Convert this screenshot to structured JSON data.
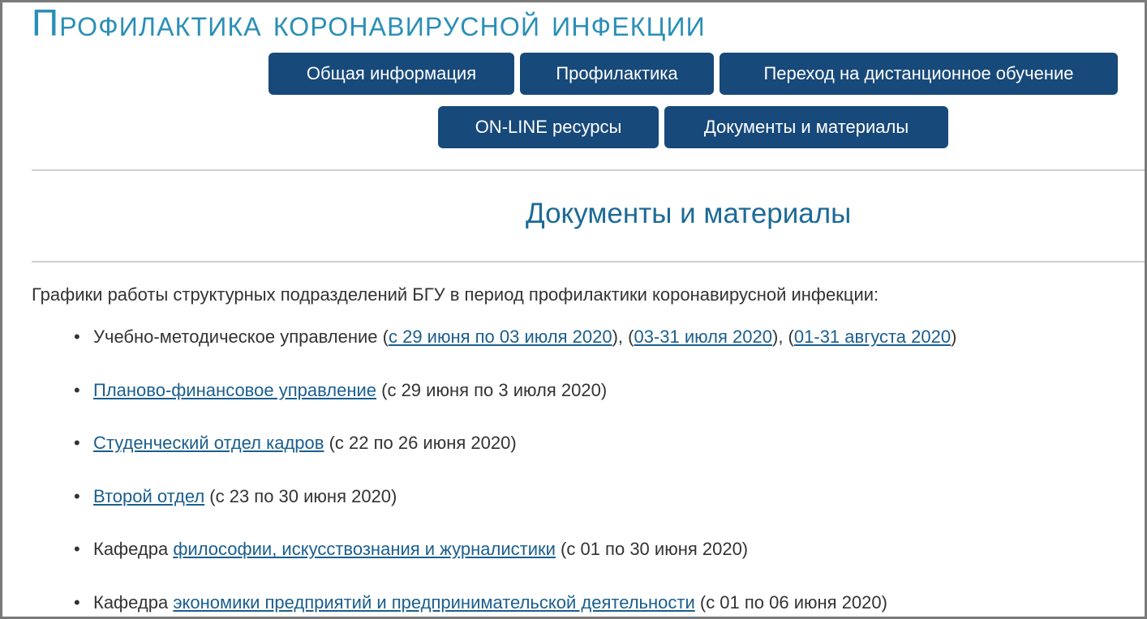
{
  "header": {
    "title": "Профилактика коронавирусной инфекции"
  },
  "nav": {
    "general": "Общая информация",
    "prevention": "Профилактика",
    "distance": "Переход на дистанционное обучение",
    "online": "ON-LINE ресурсы",
    "documents": "Документы и материалы"
  },
  "main": {
    "section_title": "Документы и материалы",
    "intro": "Графики работы структурных подразделений БГУ в период профилактики коронавирусной инфекции:",
    "items": [
      {
        "prefix": "Учебно-методическое управление (",
        "link1": "с 29 июня по 03 июля 2020",
        "sep1": "), (",
        "link2": "03-31 июля 2020",
        "sep2": "), (",
        "link3": "01-31 августа 2020",
        "suffix": ")"
      },
      {
        "link": "Планово-финансовое управление",
        "suffix": " (с 29 июня по 3 июля 2020)"
      },
      {
        "link": "Студенческий отдел кадров",
        "suffix": " (с 22 по 26 июня 2020)"
      },
      {
        "link": "Второй отдел",
        "suffix": " (с 23 по 30 июня 2020)"
      },
      {
        "prefix": "Кафедра ",
        "link": "философии, искусствознания и журналистики",
        "suffix": " (с 01 по 30 июня 2020)"
      },
      {
        "prefix": "Кафедра ",
        "link": "экономики предприятий и предпринимательской деятельности",
        "suffix": " (с 01 по 06 июня 2020)"
      }
    ]
  },
  "colors": {
    "title": "#2a8fb7",
    "nav_bg": "#17497a",
    "section_title": "#1d6a96",
    "link": "#1a5e8e",
    "text": "#333333",
    "divider": "#cfcfcf"
  }
}
